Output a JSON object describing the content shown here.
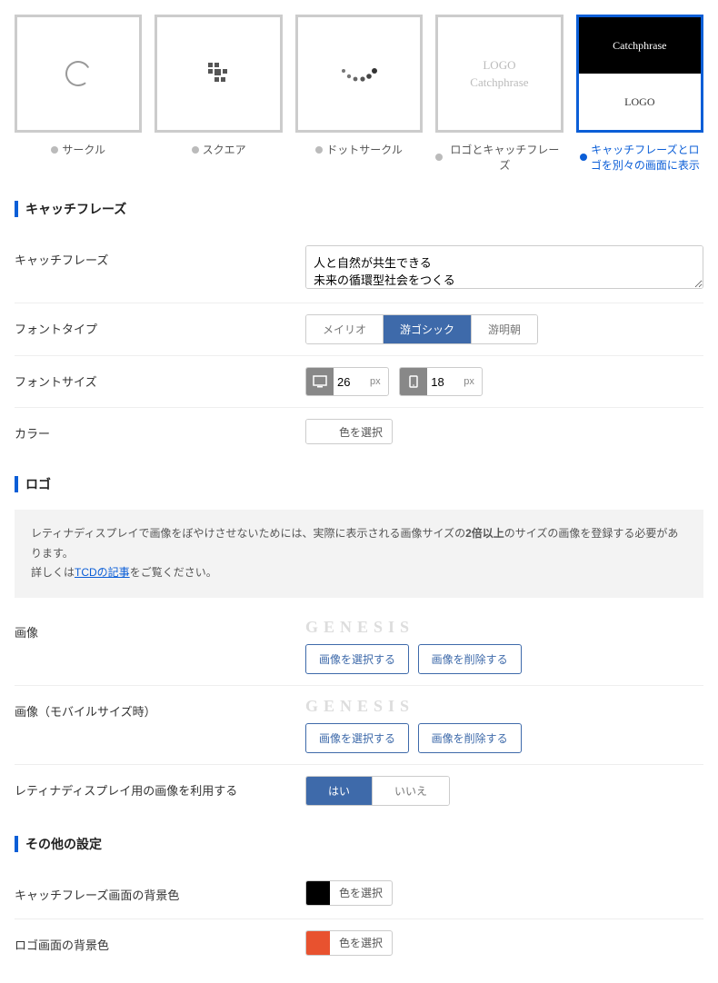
{
  "layout_options": [
    {
      "label": "サークル"
    },
    {
      "label": "スクエア"
    },
    {
      "label": "ドットサークル"
    },
    {
      "label": "ロゴとキャッチフレーズ",
      "preview_top": "LOGO",
      "preview_bottom": "Catchphrase"
    },
    {
      "label": "キャッチフレーズとロゴを別々の画面に表示",
      "preview_top": "Catchphrase",
      "preview_bottom": "LOGO"
    }
  ],
  "selected_layout": 4,
  "sections": {
    "catchphrase": {
      "title": "キャッチフレーズ",
      "fields": {
        "text_label": "キャッチフレーズ",
        "text_value": "人と自然が共生できる\n未来の循環型社会をつくる",
        "font_type_label": "フォントタイプ",
        "font_type_options": [
          "メイリオ",
          "游ゴシック",
          "游明朝"
        ],
        "font_type_selected": 1,
        "font_size_label": "フォントサイズ",
        "font_size_desktop": "26",
        "font_size_mobile": "18",
        "font_size_unit": "px",
        "color_label": "カラー",
        "color_value": "#ffffff",
        "color_button": "色を選択"
      }
    },
    "logo": {
      "title": "ロゴ",
      "info_text_1": "レティナディスプレイで画像をぼやけさせないためには、実際に表示される画像サイズの",
      "info_bold": "2倍以上",
      "info_text_2": "のサイズの画像を登録する必要があります。",
      "info_text_3": "詳しくは",
      "info_link": "TCDの記事",
      "info_text_4": "をご覧ください。",
      "image_label": "画像",
      "image_mobile_label": "画像（モバイルサイズ時）",
      "logo_text": "GENESIS",
      "select_button": "画像を選択する",
      "delete_button": "画像を削除する",
      "retina_label": "レティナディスプレイ用の画像を利用する",
      "retina_options": [
        "はい",
        "いいえ"
      ],
      "retina_selected": 0
    },
    "other": {
      "title": "その他の設定",
      "catchphrase_bg_label": "キャッチフレーズ画面の背景色",
      "catchphrase_bg_value": "#000000",
      "logo_bg_label": "ロゴ画面の背景色",
      "logo_bg_value": "#e8522f",
      "color_button": "色を選択"
    }
  }
}
